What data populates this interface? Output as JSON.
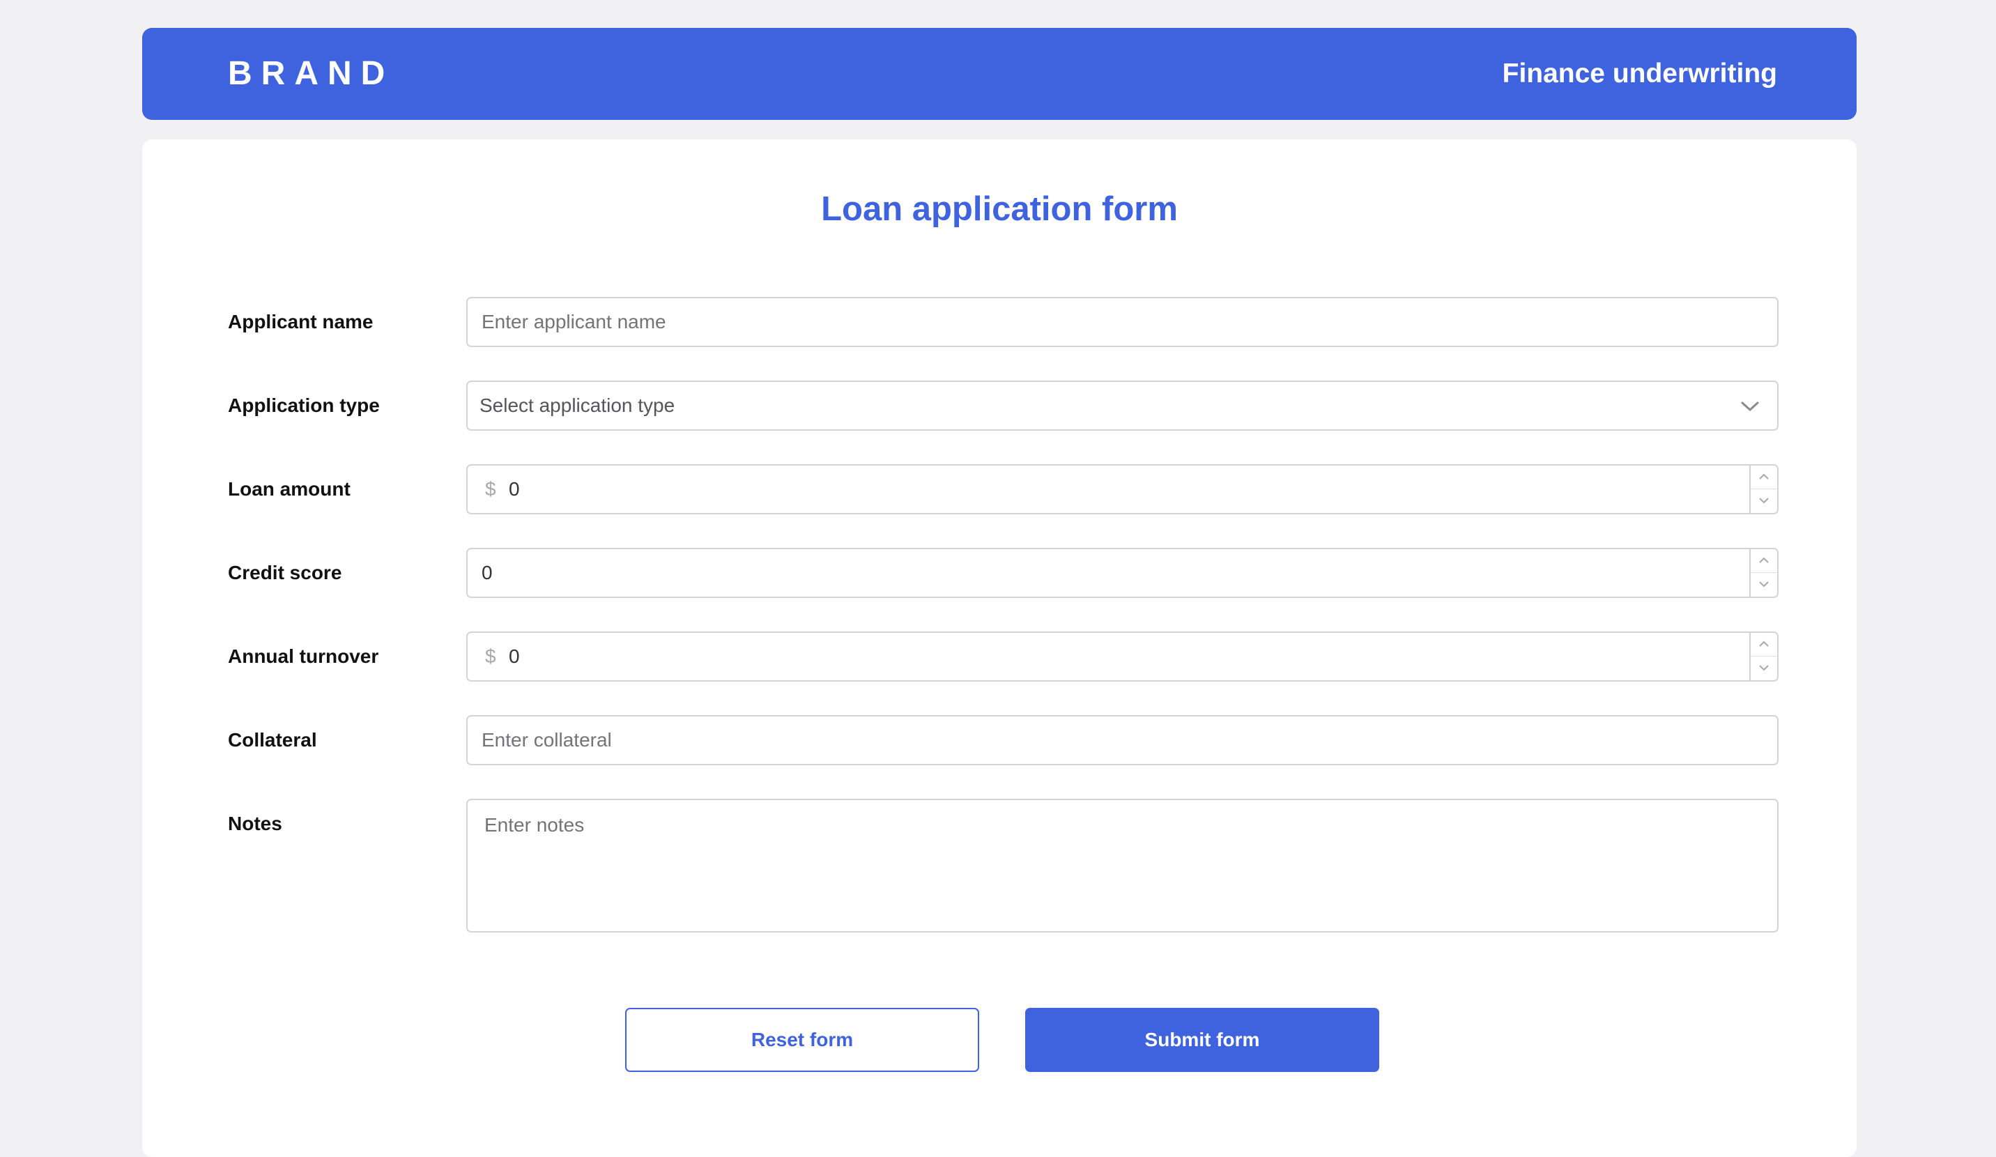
{
  "header": {
    "brand": "BRAND",
    "title": "Finance underwriting",
    "background_color": "#3f63de"
  },
  "form": {
    "title": "Loan application form",
    "fields": {
      "applicant_name": {
        "label": "Applicant name",
        "placeholder": "Enter applicant name",
        "value": ""
      },
      "application_type": {
        "label": "Application type",
        "selected": "Select application type",
        "icon": "chevron-down-icon"
      },
      "loan_amount": {
        "label": "Loan amount",
        "prefix": "$",
        "value": "0"
      },
      "credit_score": {
        "label": "Credit score",
        "value": "0"
      },
      "annual_turnover": {
        "label": "Annual turnover",
        "prefix": "$",
        "value": "0"
      },
      "collateral": {
        "label": "Collateral",
        "placeholder": "Enter collateral",
        "value": ""
      },
      "notes": {
        "label": "Notes",
        "placeholder": "Enter notes",
        "value": ""
      }
    },
    "buttons": {
      "reset": "Reset form",
      "submit": "Submit form"
    }
  }
}
